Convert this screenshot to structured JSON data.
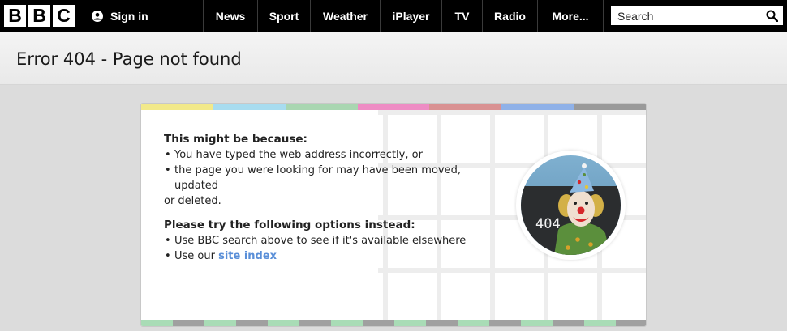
{
  "header": {
    "logo_letters": [
      "B",
      "B",
      "C"
    ],
    "sign_in_label": "Sign in",
    "nav": [
      {
        "label": "News"
      },
      {
        "label": "Sport"
      },
      {
        "label": "Weather"
      },
      {
        "label": "iPlayer"
      },
      {
        "label": "TV"
      },
      {
        "label": "Radio"
      },
      {
        "label": "More..."
      }
    ],
    "search": {
      "placeholder": "Search",
      "value": ""
    },
    "icons": {
      "user": "user-icon",
      "search": "search-icon"
    }
  },
  "page": {
    "title": "Error 404 - Page not found"
  },
  "card": {
    "colors_top": [
      "#f2e98a",
      "#a8dcef",
      "#a9d6b1",
      "#ee8cc4",
      "#d99192",
      "#8fb1e8",
      "#9a9a9a"
    ],
    "reasons_heading": "This might be because:",
    "reasons": [
      "You have typed the web address incorrectly, or",
      "the page you were looking for may have been moved, updated"
    ],
    "reasons_continuation": "or deleted.",
    "options_heading": "Please try the following options instead:",
    "options": [
      {
        "text": "Use BBC search above to see if it's available elsewhere"
      },
      {
        "text": "Use our ",
        "link": "site index"
      }
    ],
    "image": {
      "icon": "clown-404-image",
      "board_text": "404"
    }
  }
}
